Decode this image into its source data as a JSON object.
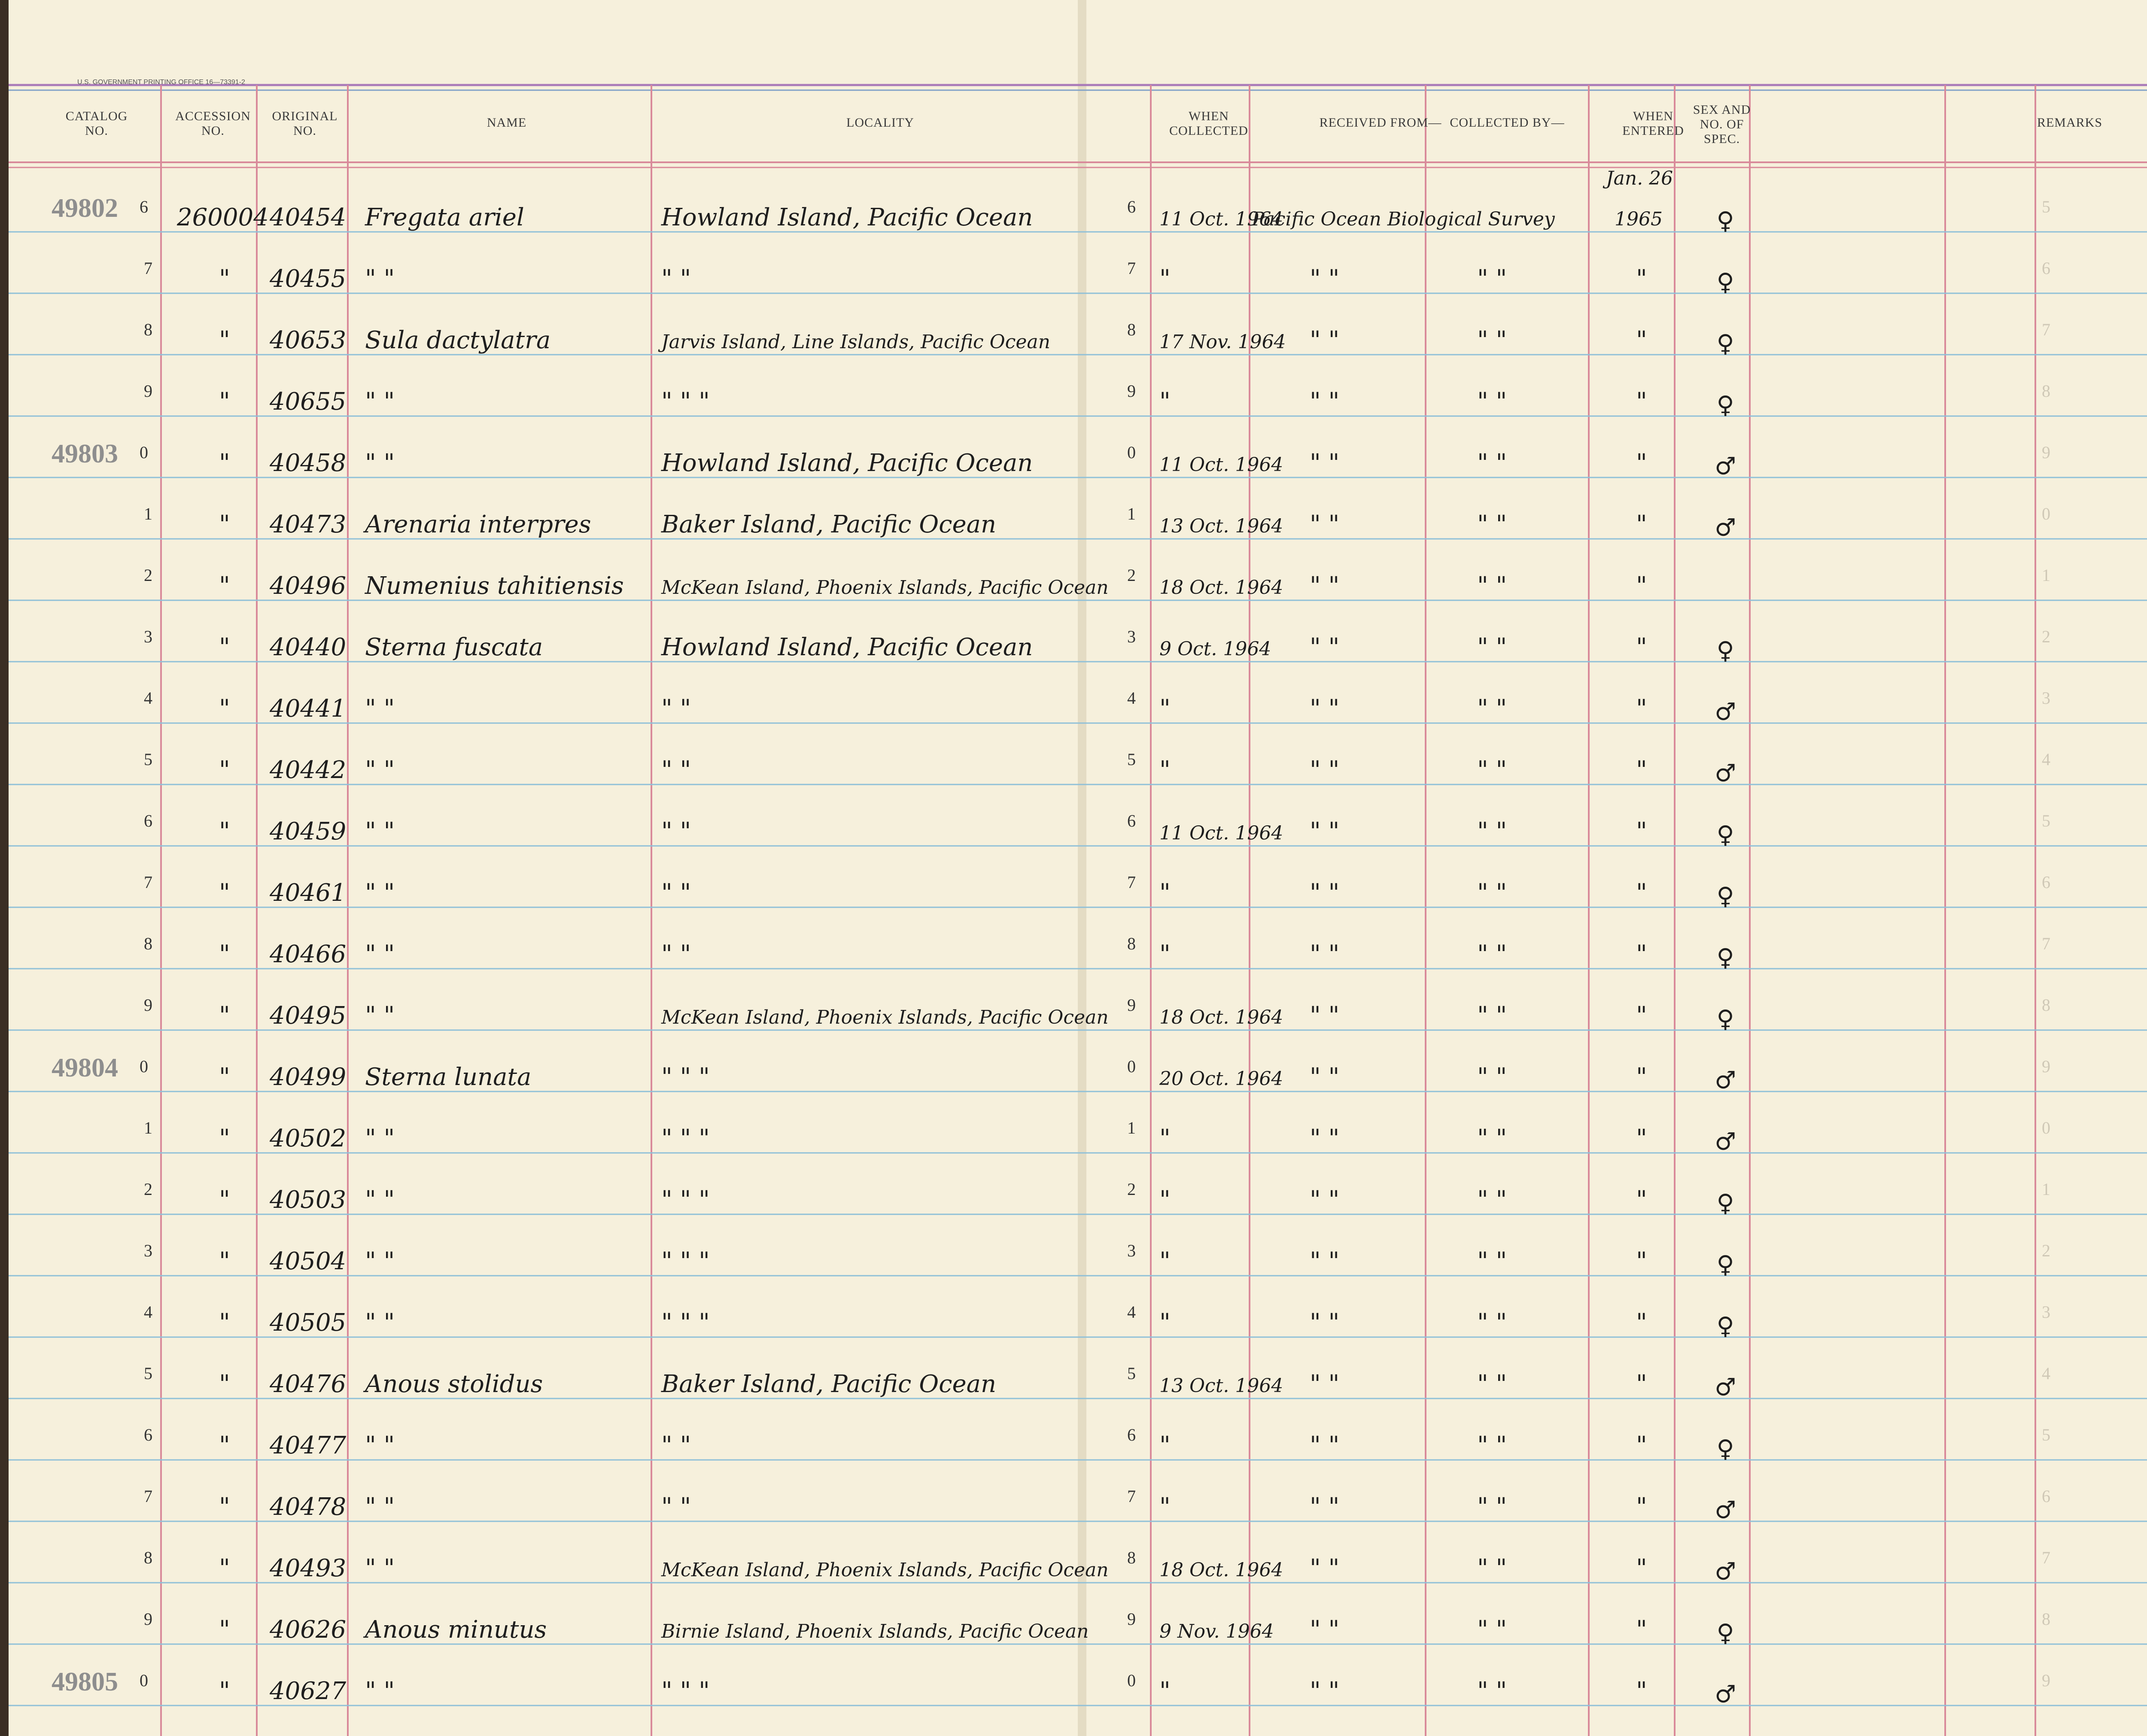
{
  "printer_line": "U.S. GOVERNMENT PRINTING OFFICE   16—73391-2",
  "columns": {
    "catalog": "Catalog No.",
    "accession": "Accession No.",
    "original": "Original No.",
    "name": "Name",
    "locality": "Locality",
    "when_collected": "When Collected",
    "received_from": "Received From—",
    "collected_by": "Collected By—",
    "when_entered": "When Entered",
    "sex": "Sex and No. of Spec.",
    "remarks": "Remarks"
  },
  "symbols": {
    "female": "♀",
    "male": "♂",
    "ditto": "\""
  },
  "entered_date": [
    "Jan. 26",
    "1965"
  ],
  "rows": [
    {
      "catalog": "49802",
      "idx": "6",
      "accession": "260004",
      "original": "40454",
      "name": "Fregata ariel",
      "locality": "Howland Island, Pacific Ocean",
      "idx2": "6",
      "collected": "11 Oct. 1964",
      "received": "Pacific Ocean Biological Survey",
      "collected_by": "",
      "entered": "",
      "sex": "♀"
    },
    {
      "catalog": "",
      "idx": "7",
      "accession": "\"",
      "original": "40455",
      "name": "\"        \"",
      "locality": "\"                    \"",
      "idx2": "7",
      "collected": "\"",
      "received": "\"      \"",
      "collected_by": "\"      \"",
      "entered": "\"",
      "sex": "♀"
    },
    {
      "catalog": "",
      "idx": "8",
      "accession": "\"",
      "original": "40653",
      "name": "Sula dactylatra",
      "locality": "Jarvis Island, Line Islands, Pacific Ocean",
      "idx2": "8",
      "collected": "17 Nov. 1964",
      "received": "\"      \"",
      "collected_by": "\"      \"",
      "entered": "\"",
      "sex": "♀"
    },
    {
      "catalog": "",
      "idx": "9",
      "accession": "\"",
      "original": "40655",
      "name": "\"        \"",
      "locality": "\"          \"          \"",
      "idx2": "9",
      "collected": "\"",
      "received": "\"      \"",
      "collected_by": "\"      \"",
      "entered": "\"",
      "sex": "♀"
    },
    {
      "catalog": "49803",
      "idx": "0",
      "accession": "\"",
      "original": "40458",
      "name": "\"        \"",
      "locality": "Howland Island,   Pacific Ocean",
      "idx2": "0",
      "collected": "11 Oct. 1964",
      "received": "\"      \"",
      "collected_by": "\"      \"",
      "entered": "\"",
      "sex": "♂"
    },
    {
      "catalog": "",
      "idx": "1",
      "accession": "\"",
      "original": "40473",
      "name": "Arenaria interpres",
      "locality": "Baker Island,   Pacific Ocean",
      "idx2": "1",
      "collected": "13 Oct. 1964",
      "received": "\"      \"",
      "collected_by": "\"      \"",
      "entered": "\"",
      "sex": "♂"
    },
    {
      "catalog": "",
      "idx": "2",
      "accession": "\"",
      "original": "40496",
      "name": "Numenius tahitiensis",
      "locality": "McKean Island, Phoenix Islands, Pacific Ocean",
      "idx2": "2",
      "collected": "18 Oct. 1964",
      "received": "\"      \"",
      "collected_by": "\"      \"",
      "entered": "\"",
      "sex": ""
    },
    {
      "catalog": "",
      "idx": "3",
      "accession": "\"",
      "original": "40440",
      "name": "Sterna fuscata",
      "locality": "Howland Island,   Pacific Ocean",
      "idx2": "3",
      "collected": "9 Oct. 1964",
      "received": "\"      \"",
      "collected_by": "\"      \"",
      "entered": "\"",
      "sex": "♀"
    },
    {
      "catalog": "",
      "idx": "4",
      "accession": "\"",
      "original": "40441",
      "name": "\"        \"",
      "locality": "\"                    \"",
      "idx2": "4",
      "collected": "\"",
      "received": "\"      \"",
      "collected_by": "\"      \"",
      "entered": "\"",
      "sex": "♂"
    },
    {
      "catalog": "",
      "idx": "5",
      "accession": "\"",
      "original": "40442",
      "name": "\"        \"",
      "locality": "\"                    \"",
      "idx2": "5",
      "collected": "\"",
      "received": "\"      \"",
      "collected_by": "\"      \"",
      "entered": "\"",
      "sex": "♂"
    },
    {
      "catalog": "",
      "idx": "6",
      "accession": "\"",
      "original": "40459",
      "name": "\"        \"",
      "locality": "\"                    \"",
      "idx2": "6",
      "collected": "11 Oct. 1964",
      "received": "\"      \"",
      "collected_by": "\"      \"",
      "entered": "\"",
      "sex": "♀"
    },
    {
      "catalog": "",
      "idx": "7",
      "accession": "\"",
      "original": "40461",
      "name": "\"        \"",
      "locality": "\"                    \"",
      "idx2": "7",
      "collected": "\"",
      "received": "\"      \"",
      "collected_by": "\"      \"",
      "entered": "\"",
      "sex": "♀"
    },
    {
      "catalog": "",
      "idx": "8",
      "accession": "\"",
      "original": "40466",
      "name": "\"        \"",
      "locality": "\"                    \"",
      "idx2": "8",
      "collected": "\"",
      "received": "\"      \"",
      "collected_by": "\"      \"",
      "entered": "\"",
      "sex": "♀"
    },
    {
      "catalog": "",
      "idx": "9",
      "accession": "\"",
      "original": "40495",
      "name": "\"        \"",
      "locality": "McKean Island, Phoenix Islands, Pacific Ocean",
      "idx2": "9",
      "collected": "18 Oct. 1964",
      "received": "\"      \"",
      "collected_by": "\"      \"",
      "entered": "\"",
      "sex": "♀"
    },
    {
      "catalog": "49804",
      "idx": "0",
      "accession": "\"",
      "original": "40499",
      "name": "Sterna lunata",
      "locality": "\"          \"          \"",
      "idx2": "0",
      "collected": "20 Oct. 1964",
      "received": "\"      \"",
      "collected_by": "\"      \"",
      "entered": "\"",
      "sex": "♂"
    },
    {
      "catalog": "",
      "idx": "1",
      "accession": "\"",
      "original": "40502",
      "name": "\"        \"",
      "locality": "\"          \"          \"",
      "idx2": "1",
      "collected": "\"",
      "received": "\"      \"",
      "collected_by": "\"      \"",
      "entered": "\"",
      "sex": "♂"
    },
    {
      "catalog": "",
      "idx": "2",
      "accession": "\"",
      "original": "40503",
      "name": "\"        \"",
      "locality": "\"          \"          \"",
      "idx2": "2",
      "collected": "\"",
      "received": "\"      \"",
      "collected_by": "\"      \"",
      "entered": "\"",
      "sex": "♀"
    },
    {
      "catalog": "",
      "idx": "3",
      "accession": "\"",
      "original": "40504",
      "name": "\"        \"",
      "locality": "\"          \"          \"",
      "idx2": "3",
      "collected": "\"",
      "received": "\"      \"",
      "collected_by": "\"      \"",
      "entered": "\"",
      "sex": "♀"
    },
    {
      "catalog": "",
      "idx": "4",
      "accession": "\"",
      "original": "40505",
      "name": "\"        \"",
      "locality": "\"          \"          \"",
      "idx2": "4",
      "collected": "\"",
      "received": "\"      \"",
      "collected_by": "\"      \"",
      "entered": "\"",
      "sex": "♀"
    },
    {
      "catalog": "",
      "idx": "5",
      "accession": "\"",
      "original": "40476",
      "name": "Anous stolidus",
      "locality": "Baker Island,   Pacific Ocean",
      "idx2": "5",
      "collected": "13 Oct. 1964",
      "received": "\"      \"",
      "collected_by": "\"      \"",
      "entered": "\"",
      "sex": "♂"
    },
    {
      "catalog": "",
      "idx": "6",
      "accession": "\"",
      "original": "40477",
      "name": "\"        \"",
      "locality": "\"                    \"",
      "idx2": "6",
      "collected": "\"",
      "received": "\"      \"",
      "collected_by": "\"      \"",
      "entered": "\"",
      "sex": "♀"
    },
    {
      "catalog": "",
      "idx": "7",
      "accession": "\"",
      "original": "40478",
      "name": "\"        \"",
      "locality": "\"                    \"",
      "idx2": "7",
      "collected": "\"",
      "received": "\"      \"",
      "collected_by": "\"      \"",
      "entered": "\"",
      "sex": "♂"
    },
    {
      "catalog": "",
      "idx": "8",
      "accession": "\"",
      "original": "40493",
      "name": "\"        \"",
      "locality": "McKean Island, Phoenix Islands, Pacific Ocean",
      "idx2": "8",
      "collected": "18 Oct. 1964",
      "received": "\"      \"",
      "collected_by": "\"      \"",
      "entered": "\"",
      "sex": "♂"
    },
    {
      "catalog": "",
      "idx": "9",
      "accession": "\"",
      "original": "40626",
      "name": "Anous minutus",
      "locality": "Birnie Island, Phoenix Islands, Pacific Ocean",
      "idx2": "9",
      "collected": "9 Nov. 1964",
      "received": "\"      \"",
      "collected_by": "\"      \"",
      "entered": "\"",
      "sex": "♀"
    },
    {
      "catalog": "49805",
      "idx": "0",
      "accession": "\"",
      "original": "40627",
      "name": "\"        \"",
      "locality": "\"          \"          \"",
      "idx2": "0",
      "collected": "\"",
      "received": "\"      \"",
      "collected_by": "\"      \"",
      "entered": "\"",
      "sex": "♂"
    }
  ]
}
